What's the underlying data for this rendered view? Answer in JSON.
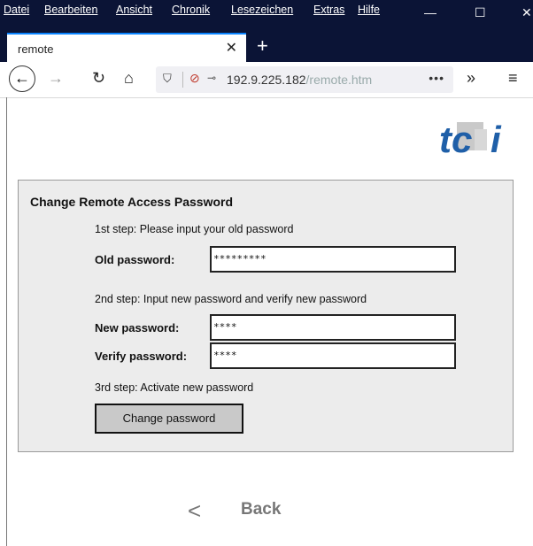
{
  "menubar": {
    "items": [
      "Datei",
      "Bearbeiten",
      "Ansicht",
      "Chronik",
      "Lesezeichen",
      "Extras",
      "Hilfe"
    ]
  },
  "tab": {
    "title": "remote"
  },
  "url": {
    "host": "192.9.225.182",
    "path": "/remote.htm"
  },
  "page": {
    "panel_title": "Change Remote Access Password",
    "step1": "1st step: Please input your old password",
    "old_label": "Old password:",
    "old_value": "*********",
    "step2": "2nd step: Input new password and verify new password",
    "new_label": "New password:",
    "new_value": "****",
    "verify_label": "Verify password:",
    "verify_value": "****",
    "step3": "3rd step: Activate new password",
    "change_button": "Change password",
    "back_label": "Back"
  },
  "colors": {
    "chrome_dark": "#0b1436",
    "accent": "#0a84ff",
    "logo_blue": "#1f5fa8",
    "panel_bg": "#ececec"
  }
}
